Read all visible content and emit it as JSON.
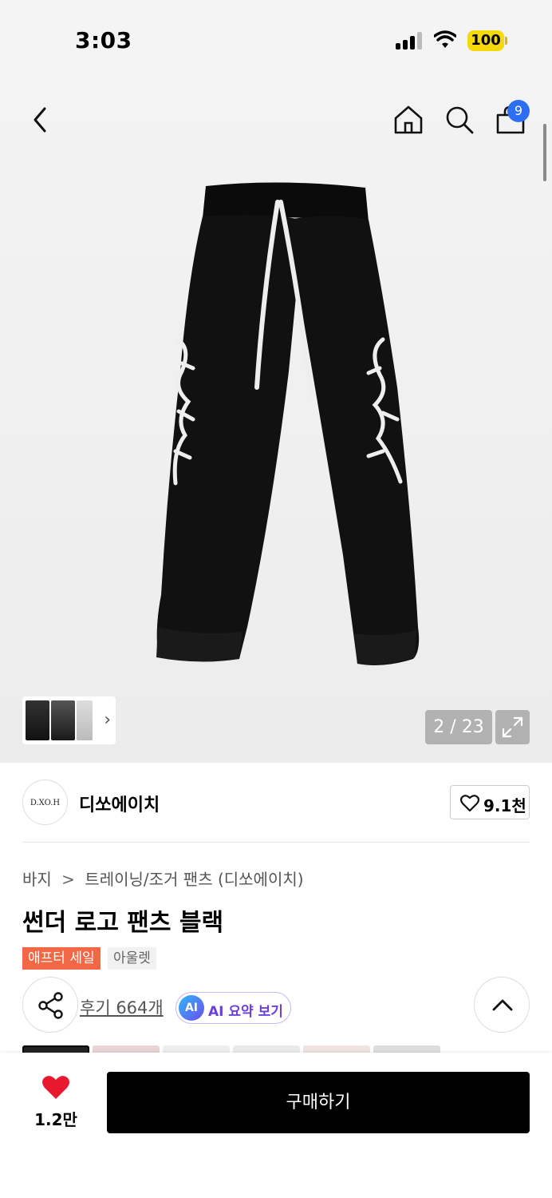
{
  "status_bar": {
    "time": "3:03",
    "battery": "100"
  },
  "header": {
    "cart_count": "9"
  },
  "gallery": {
    "page_counter": "2 / 23"
  },
  "brand": {
    "logo_text": "D.XO.H",
    "name": "디쏘에이치",
    "likes": "9.1천"
  },
  "breadcrumb": {
    "category": "바지",
    "separator": ">",
    "subcategory": "트레이닝/조거 팬츠 (디쏘에이치)"
  },
  "product": {
    "title": "썬더 로고 팬츠 블랙"
  },
  "tags": {
    "sale": "애프터 세일",
    "outlet": "아울렛"
  },
  "reviews": {
    "label": "후기 664개"
  },
  "ai_summary": {
    "badge": "AI",
    "label": "AI 요약 보기"
  },
  "bottom_bar": {
    "wish_count": "1.2만",
    "buy_label": "구매하기"
  },
  "colors": {
    "accent_sale": "#f26845",
    "cart_badge": "#2d6ff2",
    "wish_heart": "#e8182f",
    "buy_button": "#000000"
  },
  "icons": [
    "back-icon",
    "home-icon",
    "search-icon",
    "cart-icon",
    "expand-icon",
    "heart-outline-icon",
    "share-icon",
    "chevron-up-icon",
    "heart-filled-icon"
  ]
}
